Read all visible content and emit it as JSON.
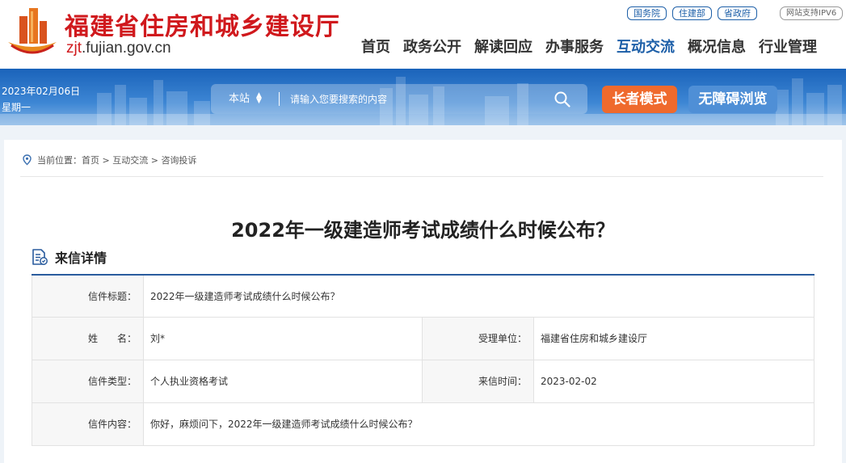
{
  "header": {
    "site_name": "福建省住房和城乡建设厅",
    "domain_prefix": "zjt",
    "domain_rest": ".fujian.gov.cn",
    "top_links": [
      "国务院",
      "住建部",
      "省政府"
    ],
    "ipv6_label": "网站支持IPV6",
    "nav": [
      "首页",
      "政务公开",
      "解读回应",
      "办事服务",
      "互动交流",
      "概况信息",
      "行业管理"
    ],
    "active_nav_index": 4,
    "brand_red": "#d0191d",
    "accent_blue": "#1d5fa8"
  },
  "banner": {
    "date": "2023年02月06日",
    "weekday": "星期一",
    "search_scope": "本站",
    "search_placeholder": "请输入您要搜索的内容",
    "elder_mode": "长者模式",
    "accessible_browse": "无障碍浏览",
    "elder_color": "#ef6a2d"
  },
  "breadcrumb": {
    "prefix": "当前位置：",
    "items": [
      "首页",
      "互动交流",
      "咨询投诉"
    ],
    "separator": " > "
  },
  "page": {
    "title": "2022年一级建造师考试成绩什么时候公布？",
    "section_title": "来信详情"
  },
  "letter": {
    "title_label": "信件标题：",
    "title_value": "2022年一级建造师考试成绩什么时候公布？",
    "name_label": "姓　　名：",
    "name_value": "刘*",
    "dept_label": "受理单位：",
    "dept_value": "福建省住房和城乡建设厅",
    "type_label": "信件类型：",
    "type_value": "个人执业资格考试",
    "time_label": "来信时间：",
    "time_value": "2023-02-02",
    "content_label": "信件内容：",
    "content_value": "你好，麻烦问下，2022年一级建造师考试成绩什么时候公布？"
  }
}
